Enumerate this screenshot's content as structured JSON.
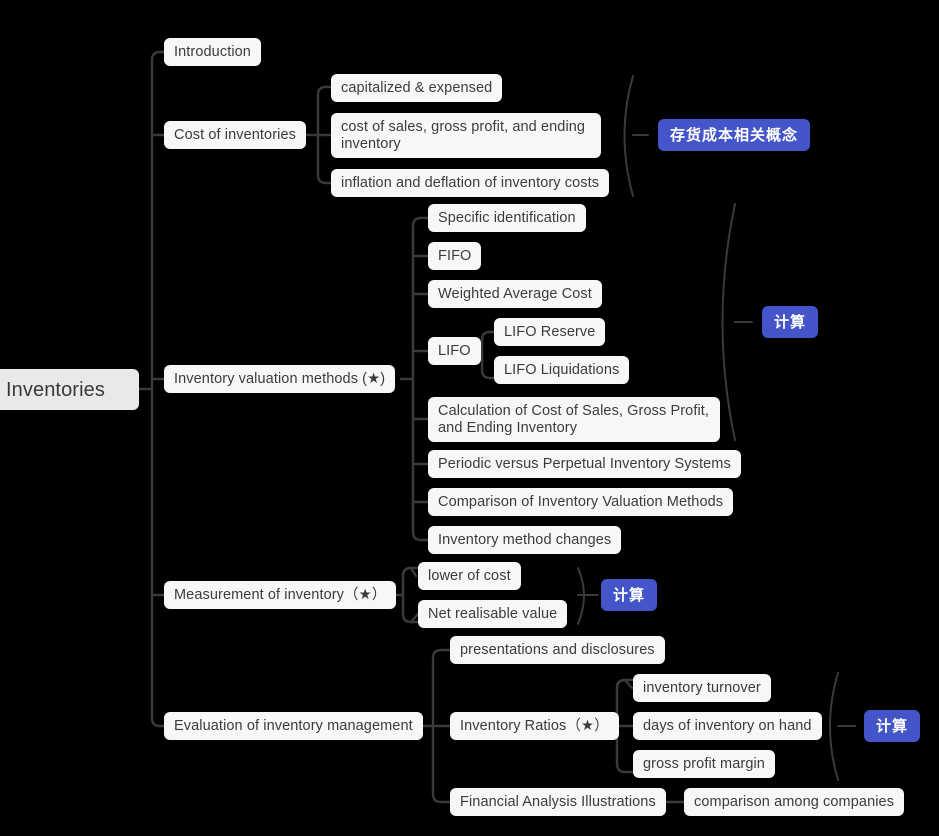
{
  "diagram": {
    "type": "mind-map",
    "title": "Inventories",
    "background_color": "#000000",
    "node_color": "#f7f7f7",
    "node_text_color": "#3c3c3c",
    "root_color": "#e9e9e9",
    "badge_color": "#4355c8",
    "badge_text_color": "#ffffff",
    "edge_color": "#3a3a3a"
  },
  "root": {
    "label": "Inventories"
  },
  "branches": [
    {
      "id": "introduction",
      "label": "Introduction",
      "children": []
    },
    {
      "id": "cost-of-inventories",
      "label": "Cost of inventories",
      "summary_badge": "存货成本相关概念",
      "children": [
        {
          "id": "capitalized-expensed",
          "label": "capitalized & expensed"
        },
        {
          "id": "cost-of-sales-gross-profit",
          "label": "cost of sales, gross profit, and ending\ninventory"
        },
        {
          "id": "inflation-deflation",
          "label": "inflation and deflation of inventory costs"
        }
      ]
    },
    {
      "id": "inventory-valuation-methods",
      "label": "Inventory valuation methods (★)",
      "summary_badge": "计算",
      "children": [
        {
          "id": "specific-identification",
          "label": "Specific identification"
        },
        {
          "id": "fifo",
          "label": "FIFO"
        },
        {
          "id": "weighted-average-cost",
          "label": "Weighted Average Cost"
        },
        {
          "id": "lifo",
          "label": "LIFO",
          "children": [
            {
              "id": "lifo-reserve",
              "label": "LIFO Reserve"
            },
            {
              "id": "lifo-liquidations",
              "label": "LIFO Liquidations"
            }
          ]
        },
        {
          "id": "calculation-cost-of-sales",
          "label": "Calculation of Cost of Sales, Gross Profit,\nand Ending  Inventory"
        },
        {
          "id": "periodic-vs-perpetual",
          "label": "Periodic versus Perpetual Inventory Systems"
        },
        {
          "id": "comparison-valuation-methods",
          "label": "Comparison of Inventory Valuation Methods"
        },
        {
          "id": "inventory-method-changes",
          "label": "Inventory method changes"
        }
      ]
    },
    {
      "id": "measurement-of-inventory",
      "label": "Measurement of inventory（★）",
      "summary_badge": "计算",
      "children": [
        {
          "id": "lower-of-cost",
          "label": "lower of cost"
        },
        {
          "id": "net-realisable-value",
          "label": "Net realisable value"
        }
      ]
    },
    {
      "id": "evaluation-of-inventory-management",
      "label": "Evaluation of inventory management",
      "children": [
        {
          "id": "presentations-disclosures",
          "label": "presentations and disclosures"
        },
        {
          "id": "inventory-ratios",
          "label": "Inventory Ratios（★）",
          "summary_badge": "计算",
          "children": [
            {
              "id": "inventory-turnover",
              "label": "inventory turnover"
            },
            {
              "id": "days-of-inventory-on-hand",
              "label": "days of inventory on hand"
            },
            {
              "id": "gross-profit-margin",
              "label": "gross profit margin"
            }
          ]
        },
        {
          "id": "financial-analysis-illustrations",
          "label": "Financial Analysis Illustrations",
          "children": [
            {
              "id": "comparison-among-companies",
              "label": "comparison among companies"
            }
          ]
        }
      ]
    }
  ]
}
